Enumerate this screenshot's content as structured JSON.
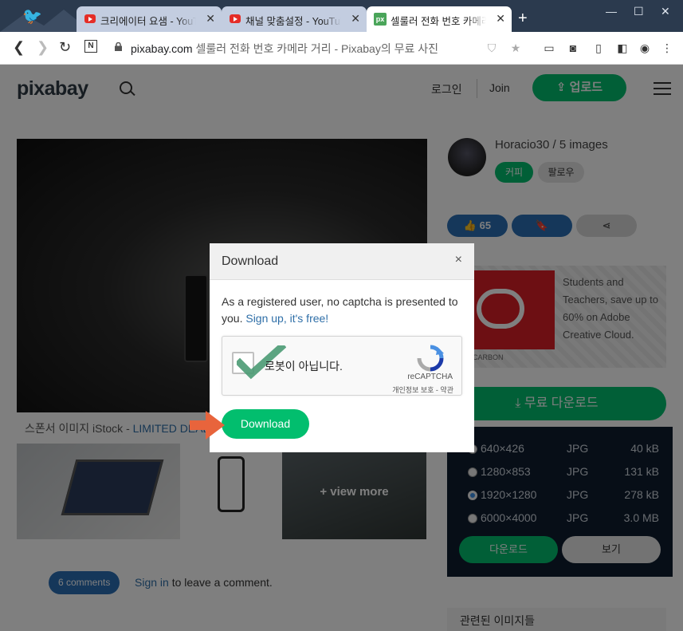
{
  "browser": {
    "tabs": [
      {
        "title": "크리에이터 요샘 - YouTube",
        "favicon": "youtube-icon",
        "active": false
      },
      {
        "title": "채널 맞춤설정 - YouTube",
        "favicon": "youtube-icon",
        "active": false
      },
      {
        "title": "셀룰러 전화 번호 카메라",
        "favicon": "pixabay-icon",
        "active": true
      }
    ],
    "url_domain": "pixabay.com",
    "url_title": "셀룰러 전화 번호 카메라 거리 - Pixabay의 무료 사진"
  },
  "header": {
    "logo": "pixabay",
    "login": "로그인",
    "join": "Join",
    "upload": "업로드"
  },
  "main": {
    "sponsor_prefix": "스폰서 이미지 iStock - ",
    "sponsor_link": "LIMITED DEAL",
    "view_more": "+ view more",
    "comments": "6 comments",
    "signin_link": "Sign in",
    "signin_rest": " to leave a comment."
  },
  "sidebar": {
    "author": "Horacio30 / 5 images",
    "coffee": "커피",
    "follow": "팔로우",
    "likes": "65",
    "ad_text": "Students and Teachers, save up to 60% on Adobe Creative Cloud.",
    "ad_by": "A CARBON",
    "free_download": "무료 다운로드",
    "sizes": [
      {
        "res": "640×426",
        "fmt": "JPG",
        "size": "40 kB",
        "selected": false
      },
      {
        "res": "1280×853",
        "fmt": "JPG",
        "size": "131 kB",
        "selected": false
      },
      {
        "res": "1920×1280",
        "fmt": "JPG",
        "size": "278 kB",
        "selected": true
      },
      {
        "res": "6000×4000",
        "fmt": "JPG",
        "size": "3.0 MB",
        "selected": false
      }
    ],
    "download_btn": "다운로드",
    "view_btn": "보기",
    "related": "관련된 이미지들"
  },
  "modal": {
    "title": "Download",
    "close": "×",
    "message": "As a registered user, no captcha is presented to you. ",
    "message_link": "Sign up, it's free!",
    "captcha_label": "로봇이 아닙니다.",
    "captcha_brand": "reCAPTCHA",
    "captcha_terms": "개인정보 보호 - 약관",
    "download": "Download"
  },
  "colors": {
    "green": "#02be6e",
    "blue": "#2a6fb5",
    "dark_panel": "#0f1c2e",
    "annotation_arrow": "#e8643c",
    "check": "#4a9a73"
  }
}
